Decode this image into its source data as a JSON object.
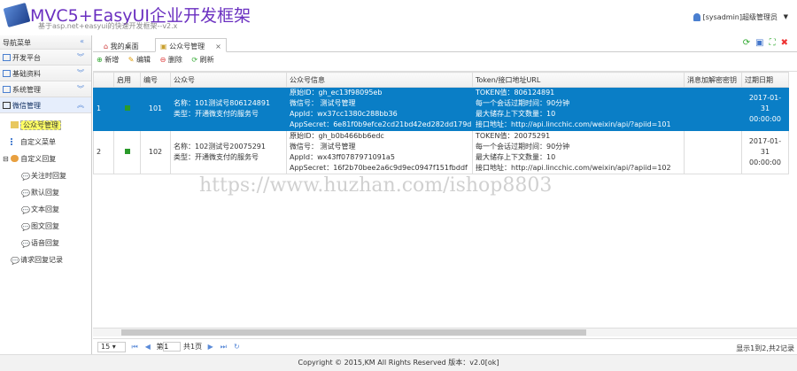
{
  "header": {
    "title": "MVC5+EasyUI企业开发框架",
    "subtitle": "基于asp.net+easyui的快速开发框架--v2.x",
    "user": "[sysadmin]超级管理员"
  },
  "sidebar": {
    "title": "导航菜单",
    "accordion": [
      {
        "label": "开发平台"
      },
      {
        "label": "基础资料"
      },
      {
        "label": "系统管理"
      },
      {
        "label": "微信管理",
        "selected": true
      }
    ],
    "tree": [
      {
        "label": "公众号管理",
        "selected": true
      },
      {
        "label": "自定义菜单"
      },
      {
        "label": "自定义回复",
        "expanded": true,
        "children": [
          {
            "label": "关注时回复"
          },
          {
            "label": "默认回复"
          },
          {
            "label": "文本回复"
          },
          {
            "label": "图文回复"
          },
          {
            "label": "语音回复"
          }
        ]
      },
      {
        "label": "请求回复记录"
      }
    ]
  },
  "tabs": [
    {
      "label": "我的桌面"
    },
    {
      "label": "公众号管理",
      "active": true
    }
  ],
  "toolbar": {
    "add": "新增",
    "edit": "编辑",
    "delete": "删除",
    "refresh": "刷新"
  },
  "grid": {
    "columns": [
      "启用",
      "编号",
      "公众号",
      "公众号信息",
      "Token/接口地址URL",
      "消息加解密密钥",
      "过期日期"
    ],
    "rows": [
      {
        "rownum": "1",
        "id": "101",
        "name": "名称：101测试号806124891",
        "type": "类型：开通微支付的服务号",
        "info": [
          "原始ID：gh_ec13f98095eb",
          "微信号： 测试号管理",
          "AppId：wx37cc1380c288bb36",
          "AppSecret：6e81f0b9efce2cd21bd42ed282dd179d"
        ],
        "token": [
          "TOKEN值：806124891",
          "每一个会话过期时间：90分钟",
          "最大储存上下文数量：10",
          "接口地址：http://api.lincchic.com/weixin/api/?apiid=101"
        ],
        "key": "",
        "expire": [
          "2017-01-31",
          "00:00:00"
        ],
        "selected": true
      },
      {
        "rownum": "2",
        "id": "102",
        "name": "名称：102测试号20075291",
        "type": "类型：开通微支付的服务号",
        "info": [
          "原始ID：gh_b0b466bb6edc",
          "微信号： 测试号管理",
          "AppId：wx43ff0787971091a5",
          "AppSecret：16f2b70bee2a6c9d9ec0947f151fbddf"
        ],
        "token": [
          "TOKEN值：20075291",
          "每一个会话过期时间：90分钟",
          "最大储存上下文数量：10",
          "接口地址：http://api.lincchic.com/weixin/api/?apiid=102"
        ],
        "key": "",
        "expire": [
          "2017-01-31",
          "00:00:00"
        ]
      }
    ]
  },
  "pager": {
    "page_size": "15",
    "page_label_before": "第",
    "page": "1",
    "page_label_after": "共1页",
    "info": "显示1到2,共2记录"
  },
  "footer": "Copyright © 2015,KM All Rights Reserved  版本：v2.0[ok]",
  "watermark": "https://www.huzhan.com/ishop8803",
  "colors": {
    "selected_row": "#0a7ec6",
    "title": "#6a2fc0"
  }
}
